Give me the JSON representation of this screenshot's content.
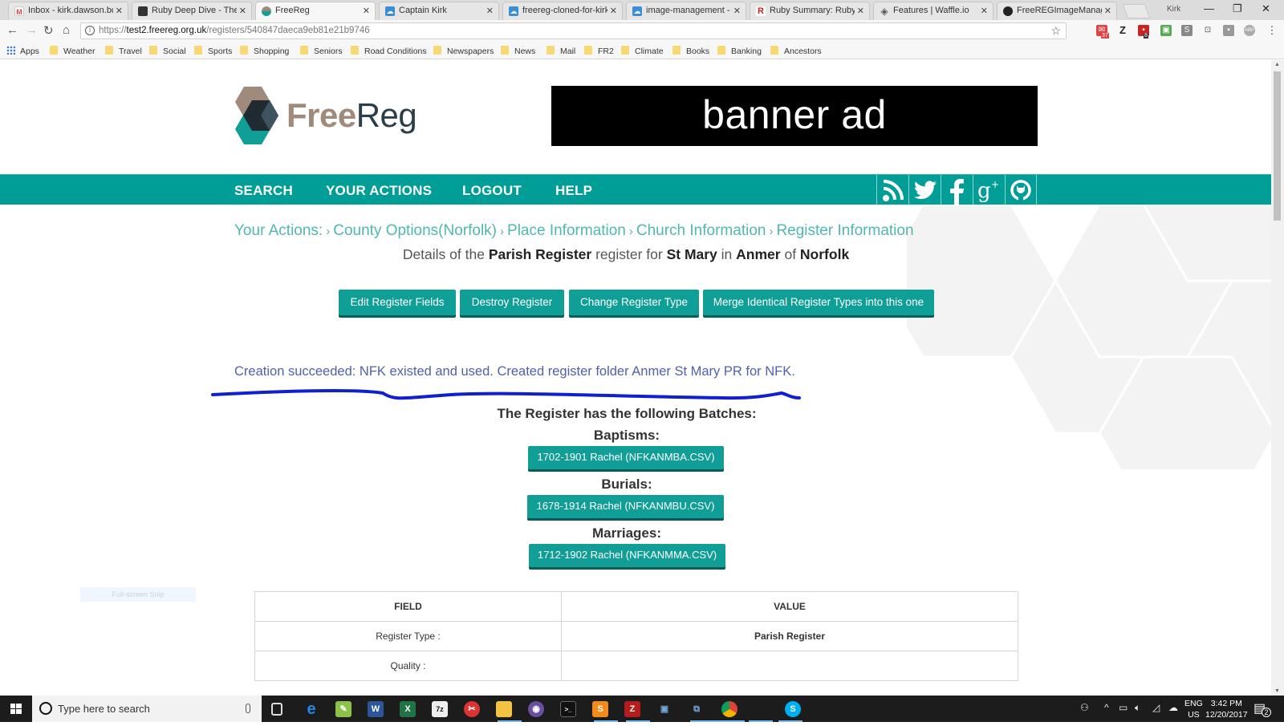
{
  "browser": {
    "tabs": [
      {
        "title": "Inbox - kirk.dawson.bc",
        "icon": "gmail-icon",
        "active": false
      },
      {
        "title": "Ruby Deep Dive - The",
        "icon": "page-icon",
        "active": false
      },
      {
        "title": "FreeReg",
        "icon": "freereg-icon",
        "active": true
      },
      {
        "title": "Captain Kirk",
        "icon": "cloud-icon",
        "active": false
      },
      {
        "title": "freereg-cloned-for-kirk",
        "icon": "cloud-icon",
        "active": false
      },
      {
        "title": "image-management -",
        "icon": "cloud-icon",
        "active": false
      },
      {
        "title": "Ruby Summary: Ruby S",
        "icon": "ruby-r-icon",
        "active": false
      },
      {
        "title": "Features | Waffle.io",
        "icon": "waffle-icon",
        "active": false
      },
      {
        "title": "FreeREGImageManage",
        "icon": "github-icon",
        "active": false
      }
    ],
    "profile_label": "Kirk",
    "url": {
      "scheme": "https://",
      "host": "test2.freereg.org.uk",
      "path": "/registers/540847daeca9eb81e21b9746"
    },
    "extension_badges": {
      "gmail_count": "37",
      "todo_count": "8"
    },
    "bookmarks": [
      {
        "label": "Apps",
        "type": "apps"
      },
      {
        "label": "Weather",
        "type": "folder"
      },
      {
        "label": "Travel",
        "type": "folder"
      },
      {
        "label": "Social",
        "type": "folder"
      },
      {
        "label": "Sports",
        "type": "folder"
      },
      {
        "label": "Shopping",
        "type": "folder"
      },
      {
        "label": "Seniors",
        "type": "folder"
      },
      {
        "label": "Road Conditions",
        "type": "folder"
      },
      {
        "label": "Newspapers",
        "type": "folder"
      },
      {
        "label": "News",
        "type": "folder"
      },
      {
        "label": "Mail",
        "type": "folder"
      },
      {
        "label": "FR2",
        "type": "folder"
      },
      {
        "label": "Climate",
        "type": "folder"
      },
      {
        "label": "Books",
        "type": "folder"
      },
      {
        "label": "Banking",
        "type": "folder"
      },
      {
        "label": "Ancestors",
        "type": "folder"
      }
    ]
  },
  "site": {
    "logo": {
      "part1": "Free",
      "part2": "Reg"
    },
    "banner_text": "banner ad",
    "nav": [
      "SEARCH",
      "YOUR ACTIONS",
      "LOGOUT",
      "HELP"
    ],
    "social": [
      "rss-icon",
      "twitter-icon",
      "facebook-icon",
      "google-plus-icon",
      "github-icon"
    ],
    "colors": {
      "teal": "#009e97",
      "button": "#0f9f97",
      "breadcrumb": "#4fb8b0",
      "flash": "#5060b0",
      "logo_brown": "#a08a7c",
      "logo_dark": "#2c3e4a"
    }
  },
  "breadcrumb": {
    "root": "Your Actions:",
    "items": [
      "County Options(Norfolk)",
      "Place Information",
      "Church Information",
      "Register Information"
    ]
  },
  "details": {
    "t1": "Details of the ",
    "register_type": "Parish Register",
    "t2": " register for ",
    "church": "St Mary",
    "t3": " in ",
    "place": "Anmer",
    "t4": " of ",
    "county": "Norfolk"
  },
  "actions": [
    "Edit Register Fields",
    "Destroy Register",
    "Change Register Type",
    "Merge Identical Register Types into this one"
  ],
  "flash_message": "Creation succeeded: NFK existed and used. Created register folder Anmer St Mary PR for NFK.",
  "batches": {
    "heading": "The Register has the following Batches:",
    "groups": [
      {
        "label": "Baptisms:",
        "batch": "1702-1901 Rachel (NFKANMBA.CSV)"
      },
      {
        "label": "Burials:",
        "batch": "1678-1914 Rachel (NFKANMBU.CSV)"
      },
      {
        "label": "Marriages:",
        "batch": "1712-1902 Rachel (NFKANMMA.CSV)"
      }
    ]
  },
  "snip_overlay": "Full-screen Snip",
  "table": {
    "headers": [
      "FIELD",
      "VALUE"
    ],
    "rows": [
      {
        "field": "Register Type :",
        "value": "Parish Register"
      },
      {
        "field": "Quality :",
        "value": ""
      }
    ]
  },
  "taskbar": {
    "search_placeholder": "Type here to search",
    "apps": [
      "task-view-icon",
      "edge-icon",
      "notepad-plus-icon",
      "word-icon",
      "excel-icon",
      "7zip-icon",
      "snipping-icon",
      "file-explorer-icon",
      "obs-icon",
      "terminal-icon",
      "sublime-icon",
      "filezilla-icon",
      "vpn-icon",
      "network-icon",
      "chrome-icon",
      "skype-icon"
    ],
    "lang_top": "ENG",
    "lang_bottom": "US",
    "time": "3:42 PM",
    "date": "12/20/2017",
    "notification_count": "2"
  }
}
